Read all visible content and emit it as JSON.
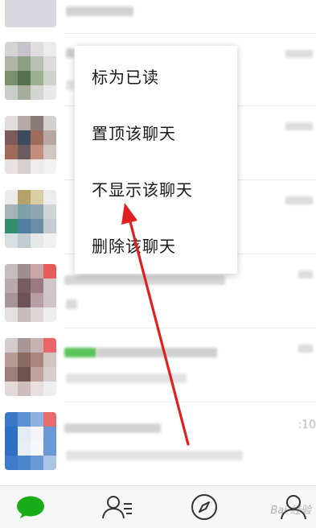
{
  "context_menu": {
    "items": [
      {
        "label": "标为已读"
      },
      {
        "label": "置顶该聊天"
      },
      {
        "label": "不显示该聊天"
      },
      {
        "label": "删除该聊天"
      }
    ]
  },
  "chat_list": {
    "times": [
      ":10"
    ]
  },
  "tab_bar": {
    "tabs": [
      {
        "icon": "chat-bubble-icon",
        "active": true
      },
      {
        "icon": "contacts-icon",
        "active": false
      },
      {
        "icon": "compass-icon",
        "active": false
      },
      {
        "icon": "me-icon",
        "active": false
      }
    ]
  },
  "watermark": {
    "text": "Bai 经验"
  },
  "colors": {
    "accent_green": "#1aad19",
    "annotation_arrow": "#e02020",
    "menu_text": "#1a1a1a",
    "tab_bar_bg": "#f7f7f7"
  }
}
